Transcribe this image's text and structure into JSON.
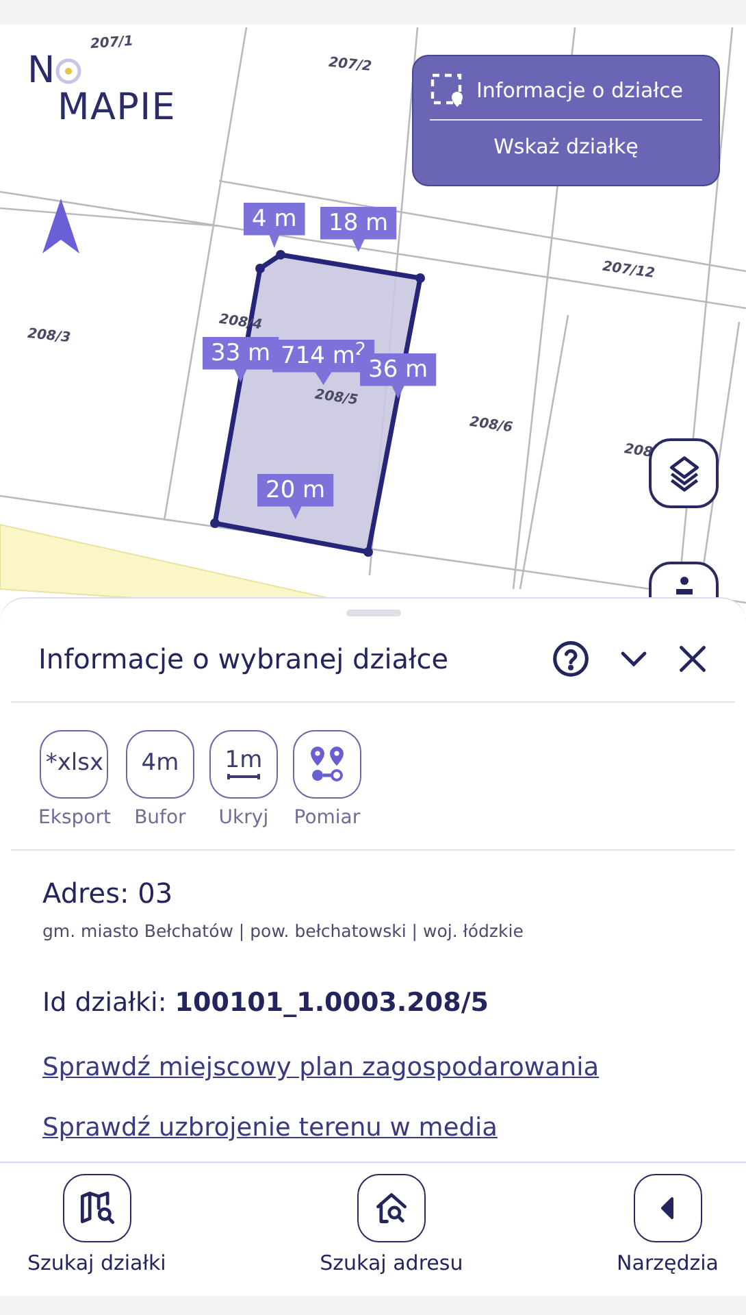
{
  "logo": {
    "first": "N",
    "second": "MAPIE"
  },
  "parcel_menu": {
    "items": [
      {
        "kind": "title",
        "label": "Informacje o działce"
      },
      {
        "kind": "action",
        "label": "Wskaż działkę"
      }
    ]
  },
  "map": {
    "parcel_labels": [
      "207/1",
      "207/2",
      "207/12",
      "208/3",
      "208/4",
      "208/5",
      "208/6",
      "208"
    ],
    "measurements": [
      "4 m",
      "18 m",
      "33 m",
      "714 m$^{2}$",
      "36 m",
      "20 m"
    ]
  },
  "sheet": {
    "title": "Informacje o wybranej działce",
    "tools": [
      {
        "kind": "text",
        "glyph": "*xlsx",
        "label": "Eksport"
      },
      {
        "kind": "text",
        "glyph": "4m",
        "label": "Bufor"
      },
      {
        "kind": "ruler",
        "glyph": "1m",
        "label": "Ukryj"
      },
      {
        "kind": "pins",
        "label": "Pomiar"
      }
    ],
    "address": {
      "title": "Adres: 03",
      "detail": "gm. miasto Bełchatów | pow. bełchatowski | woj. łódzkie"
    },
    "parcel_id": {
      "label": "Id działki:",
      "value": "100101_1.0003.208/5"
    },
    "links": [
      "Sprawdź miejscowy plan zagospodarowania",
      "Sprawdź uzbrojenie terenu w media"
    ]
  },
  "nav": [
    {
      "kind": "map-search",
      "label": "Szukaj działki"
    },
    {
      "kind": "home-search",
      "label": "Szukaj adresu"
    },
    {
      "kind": "back",
      "label": "Narzędzia"
    }
  ]
}
